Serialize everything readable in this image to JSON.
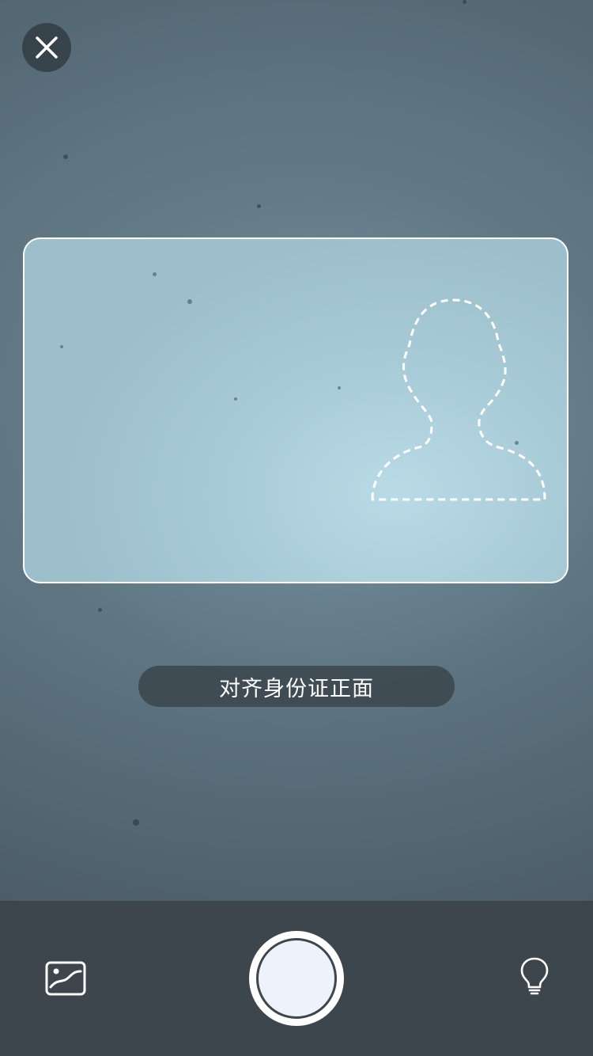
{
  "header": {
    "close_icon": "close-icon"
  },
  "frame": {
    "guide_icon": "portrait-outline-icon"
  },
  "hint": {
    "text": "对齐身份证正面"
  },
  "toolbar": {
    "gallery_icon": "gallery-icon",
    "shutter_icon": "shutter-button",
    "torch_icon": "lightbulb-icon"
  },
  "colors": {
    "toolbar_bg": "#3e464d",
    "frame_border": "#ffffff",
    "hint_bg": "#373f46"
  }
}
